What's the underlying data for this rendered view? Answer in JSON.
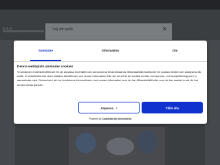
{
  "background": {
    "modal_title": "Välj ditt språk",
    "modal_close_icon": "close-icon"
  },
  "cookie_banner": {
    "tabs": [
      {
        "label": "Samtycke",
        "active": true
      },
      {
        "label": "Information",
        "active": false
      },
      {
        "label": "Om",
        "active": false
      }
    ],
    "heading": "Denna webbplats använder cookies",
    "body": "Vi använder enhetsidentifierare för att anpassa innehållet och annonserna till användarna, tillhandahålla funktioner för sociala medier och analysera vår trafik. Vi vidarebefordrar även sådana identifierare och annan information från din enhet till de sociala medier och annons- och analysföretag som vi samarbetar med. Dessa kan i sin tur kombinera informationen med annan information som du har tillhandahållit eller som de har samlat in när du har använt deras tjänster.",
    "customize_label": "Anpassa",
    "customize_icon": "chevron-right-icon",
    "allow_all_label": "Tillåt alla",
    "powered_prefix": "Powered by",
    "powered_brand": "Cookiebot by Usercentrics",
    "accent_color": "#1032cf"
  }
}
